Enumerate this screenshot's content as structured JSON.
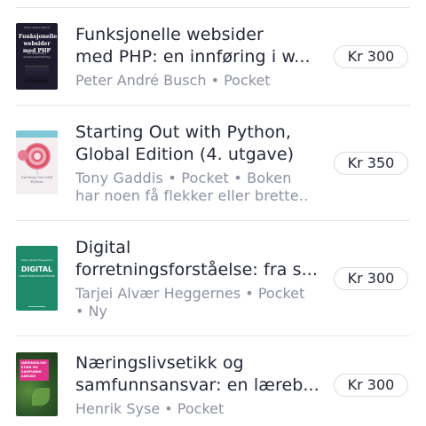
{
  "books": [
    {
      "title": "Funksjonelle websider\nmed PHP: en innføring i w...",
      "meta": "Peter André Busch • Pocket",
      "price": "Kr 300",
      "cover": {
        "top_text": "Peter André Busch",
        "title_text": "Funksjonelle websider med PHP",
        "sub_text": "En innføring i webprogrammering",
        "bg": "#1e1b2e"
      }
    },
    {
      "title": " Starting Out with Python,\nGlobal Edition (4. utgave) (...",
      "meta": "Tony Gaddis • Pocket • Boken\nhar noen få flekker eller brette..",
      "price": "Kr 350",
      "cover": {
        "title_text": "Starting Out with Python",
        "bg": "#f3eef0",
        "accent": "#d9425a"
      }
    },
    {
      "title": "Digital\nforretningsforståelse: fra s...",
      "meta": "Tarjei Alvær Heggernes • Pocket\n• Ny",
      "price": "Kr 300",
      "cover": {
        "top_text": "Tarjei Alvær Heggernes",
        "title_text": "DIGITAL",
        "sub_text": "FORRETNINGSFORSTÅELSE",
        "bg": "#1f8a6a"
      }
    },
    {
      "title": "Næringslivsetikk og\nsamfunnsansvar: en læreb...",
      "meta": "Henrik Syse • Pocket",
      "price": "Kr 300",
      "cover": {
        "title_text": "NÆRINGSLIVS-ETIKK OG SAMFUNNS-ANSVAR",
        "bg": "#2f5a2a",
        "accent": "#e0338a"
      }
    }
  ]
}
